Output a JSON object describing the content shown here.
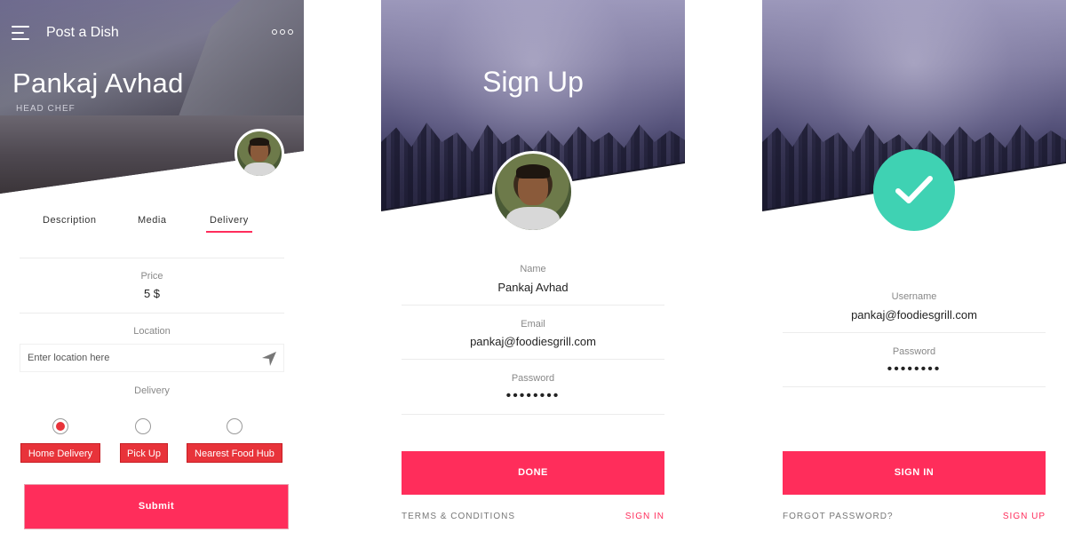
{
  "screens": {
    "post_dish": {
      "app_bar_title": "Post a Dish",
      "profile": {
        "name": "Pankaj Avhad",
        "role": "HEAD CHEF"
      },
      "tabs": [
        {
          "label": "Description",
          "active": false
        },
        {
          "label": "Media",
          "active": false
        },
        {
          "label": "Delivery",
          "active": true
        }
      ],
      "price": {
        "label": "Price",
        "value": "5 $"
      },
      "location": {
        "label": "Location",
        "placeholder": "Enter location here"
      },
      "delivery": {
        "label": "Delivery",
        "options": [
          {
            "label": "Home Delivery",
            "selected": true
          },
          {
            "label": "Pick Up",
            "selected": false
          },
          {
            "label": "Nearest Food Hub",
            "selected": false
          }
        ]
      },
      "submit_label": "Submit"
    },
    "sign_up": {
      "title": "Sign Up",
      "fields": [
        {
          "label": "Name",
          "value": "Pankaj Avhad"
        },
        {
          "label": "Email",
          "value": "pankaj@foodiesgrill.com"
        },
        {
          "label": "Password",
          "value": "••••••••"
        }
      ],
      "done_label": "DONE",
      "terms_label": "TERMS & CONDITIONS",
      "sign_in_link": "SIGN IN"
    },
    "sign_in": {
      "fields": [
        {
          "label": "Username",
          "value": "pankaj@foodiesgrill.com"
        },
        {
          "label": "Password",
          "value": "••••••••"
        }
      ],
      "sign_in_label": "SIGN IN",
      "forgot_label": "FORGOT PASSWORD?",
      "sign_up_link": "SIGN UP"
    }
  },
  "colors": {
    "accent": "#ff2d5b",
    "chip": "#e8333a",
    "success": "#3fd2b3"
  },
  "icons": [
    "hamburger-menu-icon",
    "more-dots-icon",
    "navigation-arrow-icon",
    "checkmark-icon"
  ]
}
